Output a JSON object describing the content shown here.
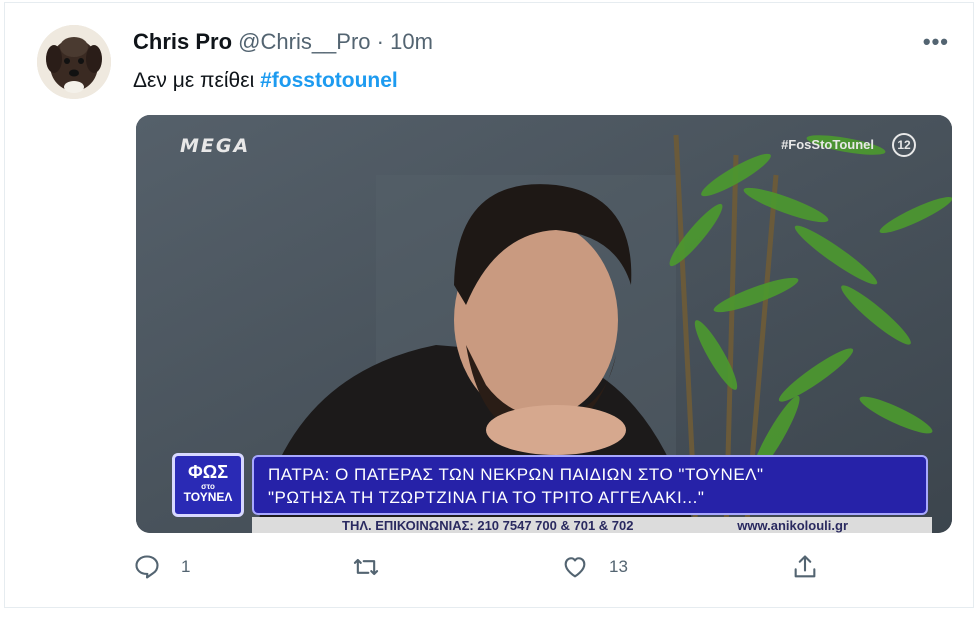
{
  "tweet": {
    "name": "Chris Pro",
    "handle": "@Chris__Pro",
    "separator": "·",
    "time": "10m",
    "more": "•••",
    "text": "Δεν με πείθει",
    "hashtag": "#fosstotounel"
  },
  "media": {
    "channel_logo": "MEGA",
    "show_hashtag": "#FosStoTounel",
    "rating": "12",
    "show_logo_line1": "ΦΩΣ",
    "show_logo_line2": "στο",
    "show_logo_line3": "ΤΟΥΝΕΛ",
    "caption_line1": "ΠΑΤΡΑ: Ο ΠΑΤΕΡΑΣ ΤΩΝ ΝΕΚΡΩΝ ΠΑΙΔΙΩΝ ΣΤΟ \"ΤΟΥΝΕΛ\"",
    "caption_line2": "\"ΡΩΤΗΣΑ ΤΗ ΤΖΩΡΤΖΙΝΑ ΓΙΑ ΤΟ ΤΡΙΤΟ ΑΓΓΕΛΑΚΙ...\"",
    "ticker_phone": "ΤΗΛ. ΕΠΙΚΟΙΝΩΝΙΑΣ: 210 7547 700 & 701 & 702",
    "ticker_web": "www.anikolouli.gr"
  },
  "actions": {
    "reply_count": "1",
    "retweet_count": "",
    "like_count": "13",
    "icons": [
      "reply-icon",
      "retweet-icon",
      "like-icon",
      "share-icon"
    ]
  },
  "colors": {
    "accent": "#1d9bf0",
    "muted": "#536471",
    "lower_third": "#2622a8"
  }
}
